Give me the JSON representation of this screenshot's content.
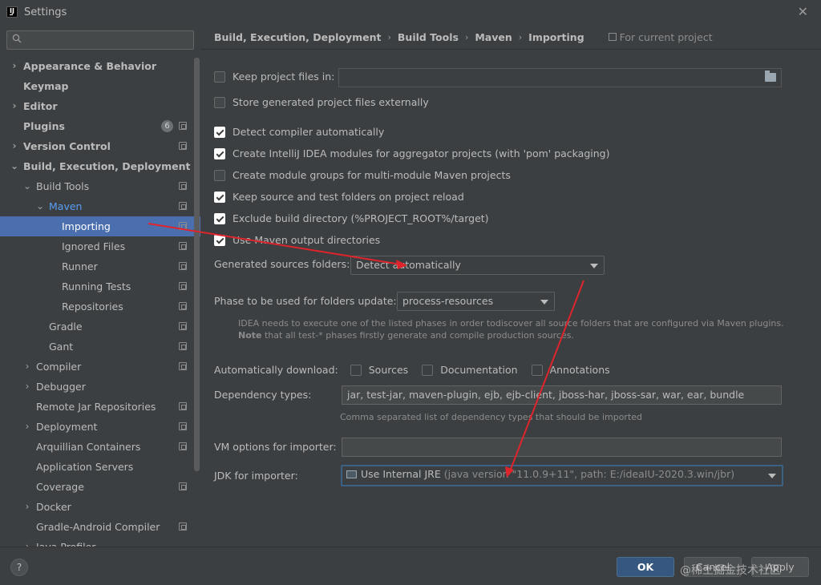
{
  "window": {
    "app_icon": "intellij-logo",
    "app_icon_letter": "IJ",
    "title": "Settings",
    "close_glyph": "✕"
  },
  "sidebar": {
    "search_placeholder": "",
    "items": [
      {
        "label": "Appearance & Behavior",
        "chevron": "›",
        "level": 0,
        "bold": true
      },
      {
        "label": "Keymap",
        "chevron": "",
        "level": 0,
        "bold": true
      },
      {
        "label": "Editor",
        "chevron": "›",
        "level": 0,
        "bold": true
      },
      {
        "label": "Plugins",
        "chevron": "",
        "level": 0,
        "bold": true,
        "badge": "6",
        "project": true
      },
      {
        "label": "Version Control",
        "chevron": "›",
        "level": 0,
        "bold": true,
        "project": true
      },
      {
        "label": "Build, Execution, Deployment",
        "chevron": "⌄",
        "level": 0,
        "bold": true
      },
      {
        "label": "Build Tools",
        "chevron": "⌄",
        "level": 1,
        "project": true
      },
      {
        "label": "Maven",
        "chevron": "⌄",
        "level": 2,
        "project": true,
        "blue": true
      },
      {
        "label": "Importing",
        "chevron": "",
        "level": 3,
        "project": true,
        "selected": true
      },
      {
        "label": "Ignored Files",
        "chevron": "",
        "level": 3,
        "project": true
      },
      {
        "label": "Runner",
        "chevron": "",
        "level": 3,
        "project": true
      },
      {
        "label": "Running Tests",
        "chevron": "",
        "level": 3,
        "project": true
      },
      {
        "label": "Repositories",
        "chevron": "",
        "level": 3,
        "project": true
      },
      {
        "label": "Gradle",
        "chevron": "",
        "level": 2,
        "project": true
      },
      {
        "label": "Gant",
        "chevron": "",
        "level": 2,
        "project": true
      },
      {
        "label": "Compiler",
        "chevron": "›",
        "level": 1,
        "project": true
      },
      {
        "label": "Debugger",
        "chevron": "›",
        "level": 1
      },
      {
        "label": "Remote Jar Repositories",
        "chevron": "",
        "level": 1,
        "project": true
      },
      {
        "label": "Deployment",
        "chevron": "›",
        "level": 1,
        "project": true
      },
      {
        "label": "Arquillian Containers",
        "chevron": "",
        "level": 1,
        "project": true
      },
      {
        "label": "Application Servers",
        "chevron": "",
        "level": 1
      },
      {
        "label": "Coverage",
        "chevron": "",
        "level": 1,
        "project": true
      },
      {
        "label": "Docker",
        "chevron": "›",
        "level": 1
      },
      {
        "label": "Gradle-Android Compiler",
        "chevron": "",
        "level": 1,
        "project": true
      },
      {
        "label": "Java Profiler",
        "chevron": "›",
        "level": 1
      }
    ]
  },
  "breadcrumb": {
    "items": [
      "Build, Execution, Deployment",
      "Build Tools",
      "Maven",
      "Importing"
    ],
    "separator": "›",
    "scope": "For current project"
  },
  "settings": {
    "keep_project_files": {
      "label": "Keep project files in:",
      "checked": false,
      "value": ""
    },
    "store_externally": {
      "label": "Store generated project files externally",
      "checked": false
    },
    "checkboxes": [
      {
        "label": "Detect compiler automatically",
        "checked": true
      },
      {
        "label": "Create IntelliJ IDEA modules for aggregator projects (with 'pom' packaging)",
        "checked": true
      },
      {
        "label": "Create module groups for multi-module Maven projects",
        "checked": false
      },
      {
        "label": "Keep source and test folders on project reload",
        "checked": true
      },
      {
        "label": "Exclude build directory (%PROJECT_ROOT%/target)",
        "checked": true
      },
      {
        "label": "Use Maven output directories",
        "checked": true
      }
    ],
    "generated_sources": {
      "label": "Generated sources folders:",
      "value": "Detect automatically"
    },
    "phase": {
      "label": "Phase to be used for folders update:",
      "value": "process-resources"
    },
    "phase_hint_line1": "IDEA needs to execute one of the listed phases in order todiscover all source folders that are configured via Maven plugins.",
    "phase_hint_note": "Note",
    "phase_hint_line2": " that all test-* phases firstly generate and compile production sources.",
    "auto_download": {
      "label": "Automatically download:",
      "options": [
        {
          "label": "Sources",
          "checked": false
        },
        {
          "label": "Documentation",
          "checked": false
        },
        {
          "label": "Annotations",
          "checked": false
        }
      ]
    },
    "dependency_types": {
      "label": "Dependency types:",
      "value": "jar, test-jar, maven-plugin, ejb, ejb-client, jboss-har, jboss-sar, war, ear, bundle",
      "hint": "Comma separated list of dependency types that should be imported"
    },
    "vm_options": {
      "label": "VM options for importer:",
      "value": ""
    },
    "jdk": {
      "label": "JDK for importer:",
      "value": "Use Internal JRE",
      "detail": "(java version \"11.0.9+11\", path: E:/ideaIU-2020.3.win/jbr)"
    }
  },
  "footer": {
    "help_label": "?",
    "ok_label": "OK",
    "cancel_label": "Cancel",
    "apply_label": "Apply",
    "watermark": "@稀土掘金技术社区"
  },
  "colors": {
    "background": "#3c3f41",
    "selection": "#4b6eaf",
    "link_blue": "#589df6",
    "ok_button": "#365880",
    "annotation_arrow": "#e0242b"
  }
}
